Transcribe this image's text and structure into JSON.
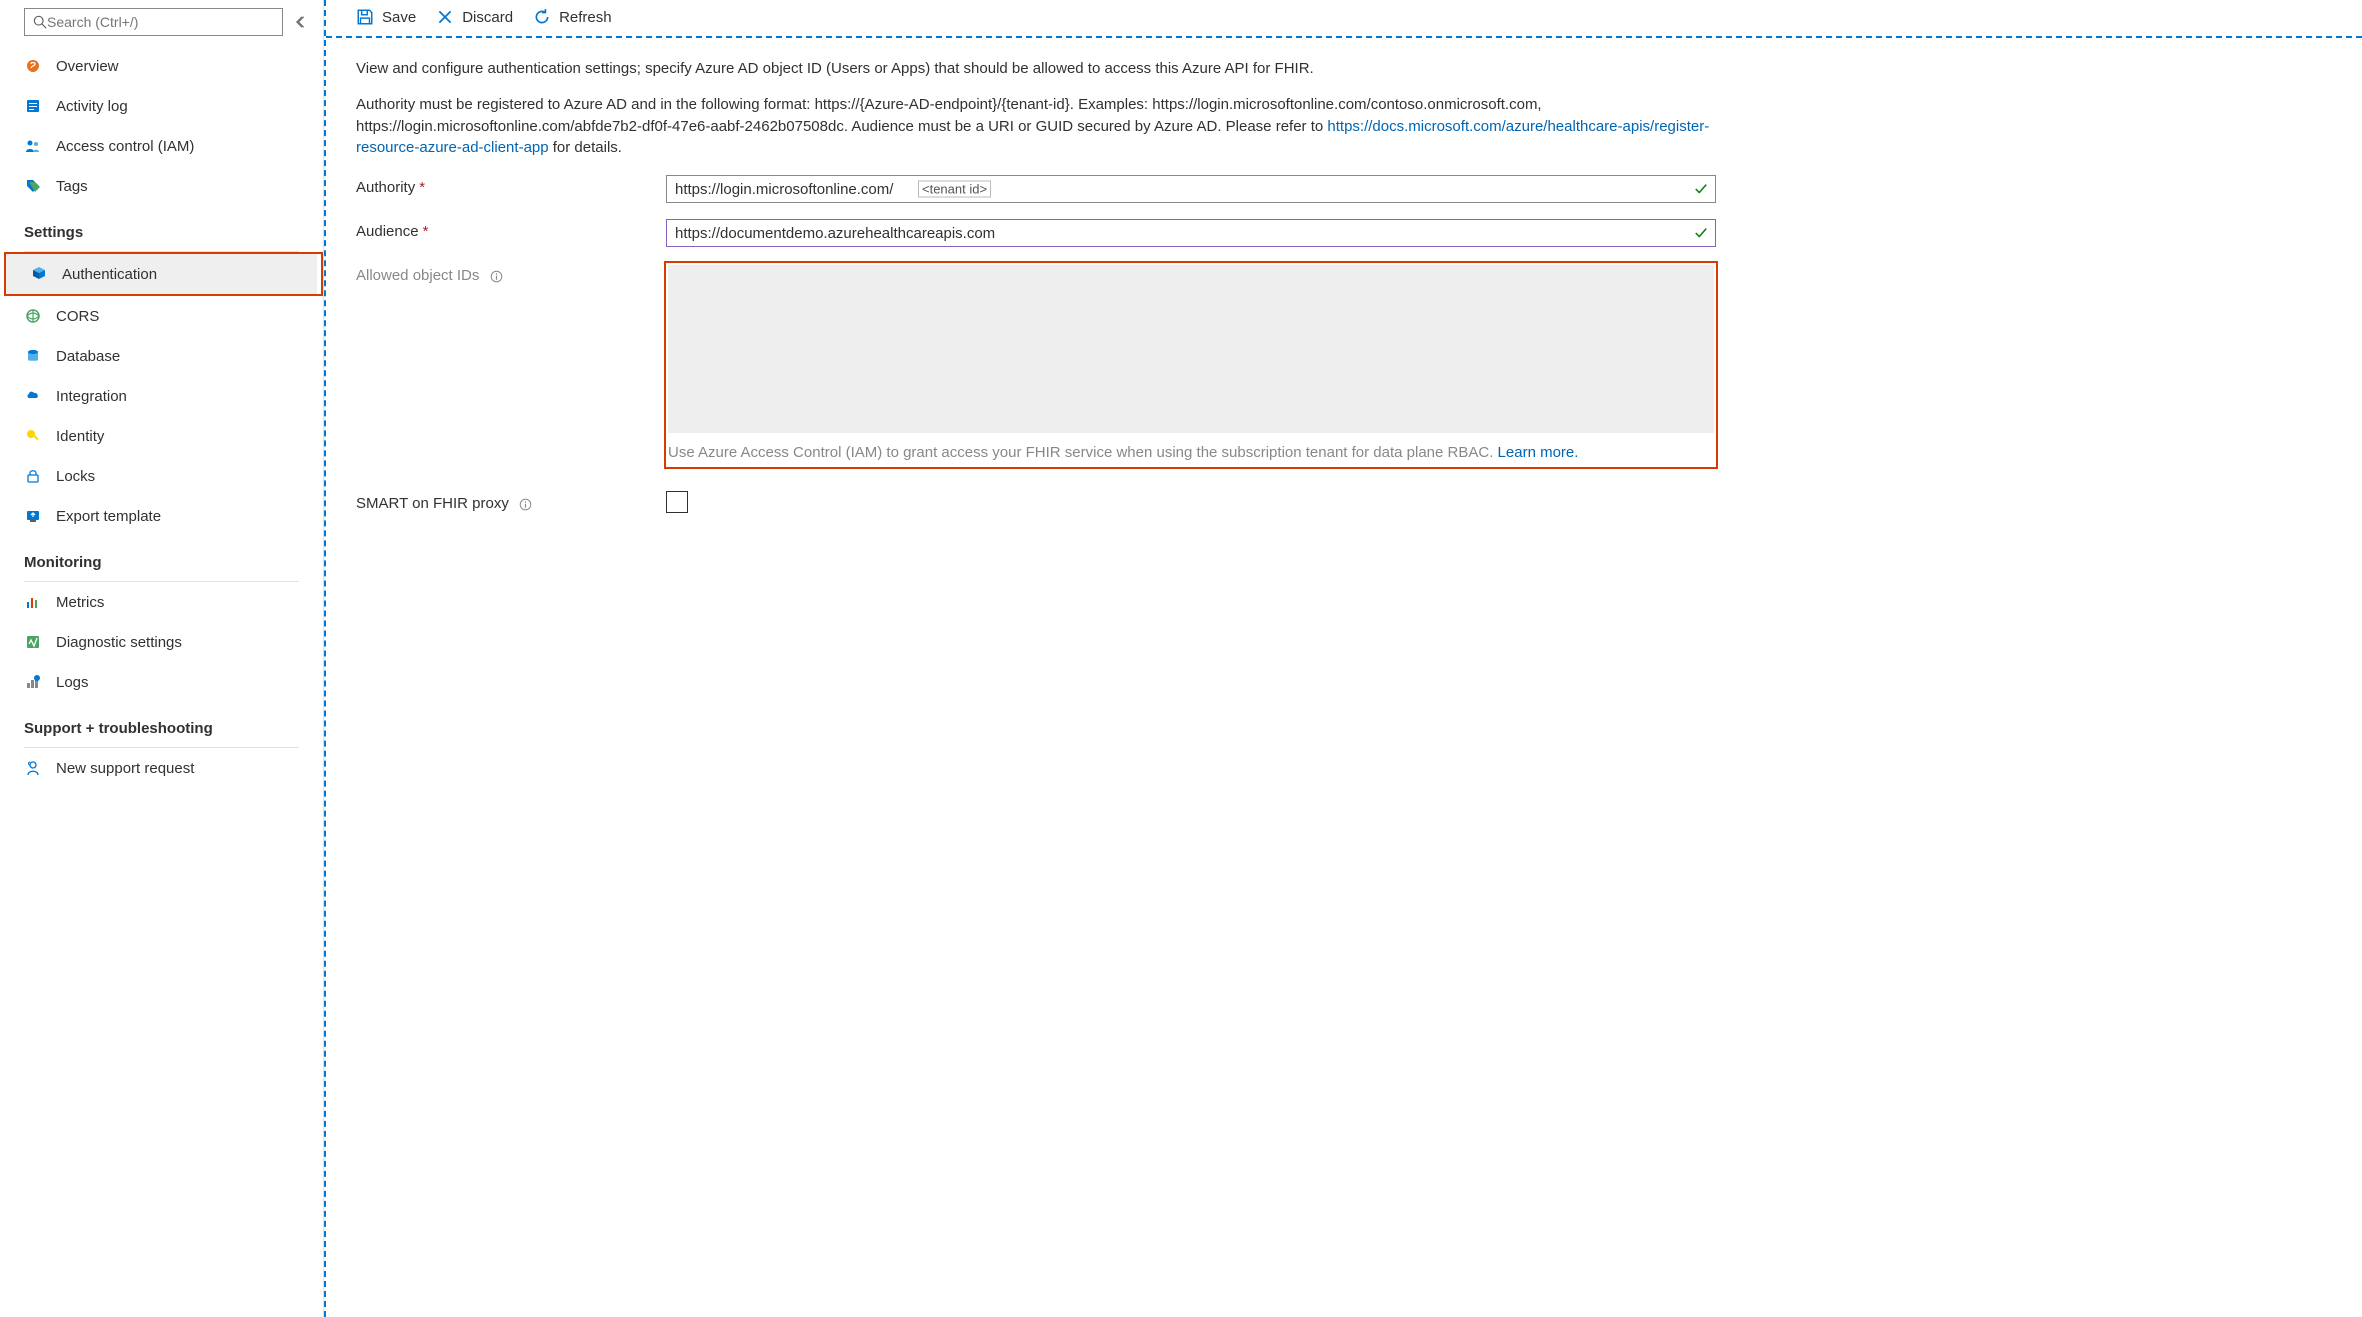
{
  "search": {
    "placeholder": "Search (Ctrl+/)"
  },
  "sidebar": {
    "top": [
      {
        "label": "Overview"
      },
      {
        "label": "Activity log"
      },
      {
        "label": "Access control (IAM)"
      },
      {
        "label": "Tags"
      }
    ],
    "groups": {
      "settings": "Settings",
      "monitoring": "Monitoring",
      "support": "Support + troubleshooting"
    },
    "settings": [
      {
        "label": "Authentication"
      },
      {
        "label": "CORS"
      },
      {
        "label": "Database"
      },
      {
        "label": "Integration"
      },
      {
        "label": "Identity"
      },
      {
        "label": "Locks"
      },
      {
        "label": "Export template"
      }
    ],
    "monitoring": [
      {
        "label": "Metrics"
      },
      {
        "label": "Diagnostic settings"
      },
      {
        "label": "Logs"
      }
    ],
    "support": [
      {
        "label": "New support request"
      }
    ]
  },
  "toolbar": {
    "save": "Save",
    "discard": "Discard",
    "refresh": "Refresh"
  },
  "intro": {
    "p1": "View and configure authentication settings; specify Azure AD object ID (Users or Apps) that should be allowed to access this Azure API for FHIR.",
    "p2a": "Authority must be registered to Azure AD and in the following format: https://{Azure-AD-endpoint}/{tenant-id}. Examples: https://login.microsoftonline.com/contoso.onmicrosoft.com, https://login.microsoftonline.com/abfde7b2-df0f-47e6-aabf-2462b07508dc. Audience must be a URI or GUID secured by Azure AD. Please refer to ",
    "p2link": "https://docs.microsoft.com/azure/healthcare-apis/register-resource-azure-ad-client-app",
    "p2b": " for details."
  },
  "form": {
    "authority_label": "Authority",
    "authority_value": "https://login.microsoftonline.com/",
    "authority_hint": "<tenant id>",
    "audience_label": "Audience",
    "audience_value": "https://documentdemo.azurehealthcareapis.com",
    "allowed_label": "Allowed object IDs",
    "allowed_help": "Use Azure Access Control (IAM) to grant access your FHIR service when using the subscription tenant for data plane RBAC. ",
    "allowed_learn": "Learn more.",
    "smart_label": "SMART on FHIR proxy"
  }
}
